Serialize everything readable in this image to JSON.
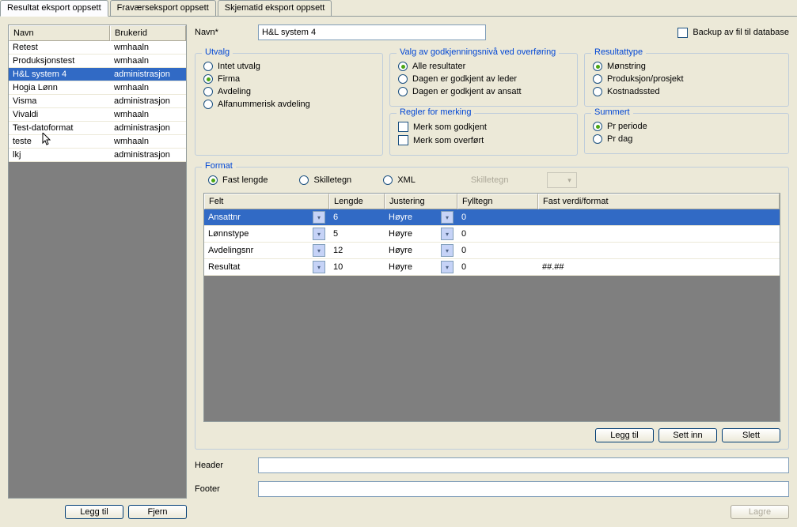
{
  "tabs": [
    {
      "label": "Resultat eksport oppsett",
      "active": true
    },
    {
      "label": "Fraværseksport oppsett",
      "active": false
    },
    {
      "label": "Skjematid eksport oppsett",
      "active": false
    }
  ],
  "left_list": {
    "headers": {
      "col1": "Navn",
      "col2": "Brukerid"
    },
    "rows": [
      {
        "name": "Retest",
        "user": "wmhaaln",
        "selected": false
      },
      {
        "name": "Produksjonstest",
        "user": "wmhaaln",
        "selected": false
      },
      {
        "name": "H&L system 4",
        "user": "administrasjon",
        "selected": true
      },
      {
        "name": "Hogia Lønn",
        "user": "wmhaaln",
        "selected": false
      },
      {
        "name": "Visma",
        "user": "administrasjon",
        "selected": false
      },
      {
        "name": "Vivaldi",
        "user": "wmhaaln",
        "selected": false
      },
      {
        "name": "Test-datoformat",
        "user": "administrasjon",
        "selected": false
      },
      {
        "name": "teste",
        "user": "wmhaaln",
        "selected": false
      },
      {
        "name": "lkj",
        "user": "administrasjon",
        "selected": false
      }
    ],
    "buttons": {
      "add": "Legg til",
      "remove": "Fjern"
    }
  },
  "form": {
    "name_label": "Navn*",
    "name_value": "H&L system 4",
    "backup_label": "Backup av fil til database"
  },
  "utvalg": {
    "title": "Utvalg",
    "options": [
      {
        "label": "Intet utvalg",
        "checked": false
      },
      {
        "label": "Firma",
        "checked": true
      },
      {
        "label": "Avdeling",
        "checked": false
      },
      {
        "label": "Alfanummerisk avdeling",
        "checked": false
      }
    ]
  },
  "godkjenning": {
    "title": "Valg av godkjenningsnivå ved overføring",
    "options": [
      {
        "label": "Alle resultater",
        "checked": true
      },
      {
        "label": "Dagen er godkjent av leder",
        "checked": false
      },
      {
        "label": "Dagen er godkjent av ansatt",
        "checked": false
      }
    ]
  },
  "resultattype": {
    "title": "Resultattype",
    "options": [
      {
        "label": "Mønstring",
        "checked": true
      },
      {
        "label": "Produksjon/prosjekt",
        "checked": false
      },
      {
        "label": "Kostnadssted",
        "checked": false
      }
    ]
  },
  "merking": {
    "title": "Regler for merking",
    "checks": [
      {
        "label": "Merk som godkjent"
      },
      {
        "label": "Merk som overført"
      }
    ]
  },
  "summert": {
    "title": "Summert",
    "options": [
      {
        "label": "Pr periode",
        "checked": true
      },
      {
        "label": "Pr dag",
        "checked": false
      }
    ]
  },
  "format": {
    "title": "Format",
    "options": [
      {
        "label": "Fast lengde",
        "checked": true
      },
      {
        "label": "Skilletegn",
        "checked": false
      },
      {
        "label": "XML",
        "checked": false
      }
    ],
    "skilletegn_label": "Skilletegn",
    "grid_headers": {
      "c1": "Felt",
      "c2": "Lengde",
      "c3": "Justering",
      "c4": "Fylltegn",
      "c5": "Fast verdi/format"
    },
    "grid_rows": [
      {
        "felt": "Ansattnr",
        "lengde": "6",
        "justering": "Høyre",
        "fylltegn": "0",
        "fast": "",
        "selected": true
      },
      {
        "felt": "Lønnstype",
        "lengde": "5",
        "justering": "Høyre",
        "fylltegn": "0",
        "fast": "",
        "selected": false
      },
      {
        "felt": "Avdelingsnr",
        "lengde": "12",
        "justering": "Høyre",
        "fylltegn": "0",
        "fast": "",
        "selected": false
      },
      {
        "felt": "Resultat",
        "lengde": "10",
        "justering": "Høyre",
        "fylltegn": "0",
        "fast": "##.##",
        "selected": false
      }
    ],
    "buttons": {
      "add": "Legg til",
      "insert": "Sett inn",
      "del": "Slett"
    }
  },
  "header_label": "Header",
  "footer_label": "Footer",
  "lagre_label": "Lagre"
}
